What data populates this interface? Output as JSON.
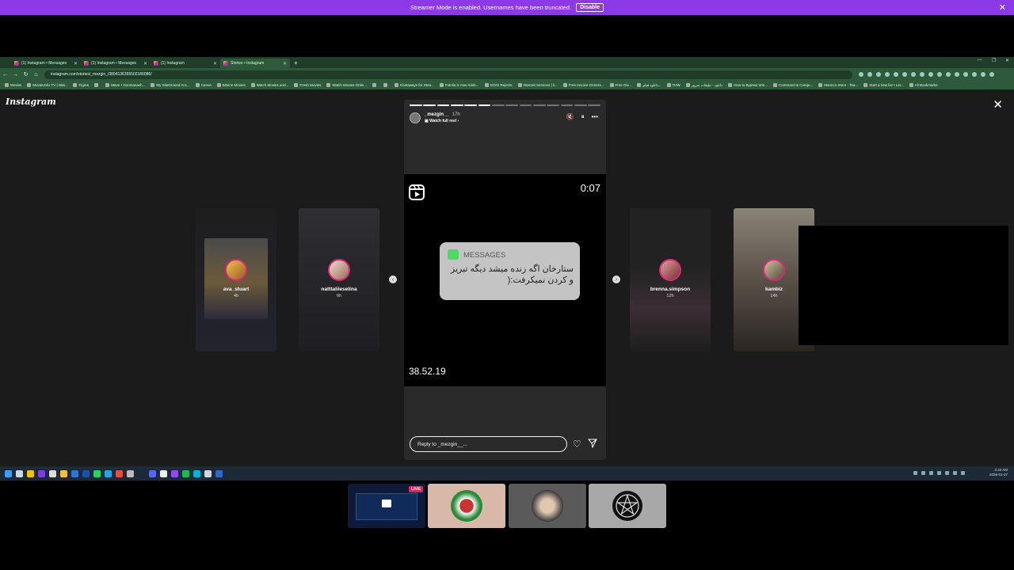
{
  "banner": {
    "text": "Streamer Mode is enabled. Usernames have been truncated.",
    "disable_label": "Disable",
    "close": "✕",
    "color": "#8c3ae8"
  },
  "browser": {
    "tabs": [
      {
        "label": "(1) Instagram • Messages",
        "active": false
      },
      {
        "label": "(1) Instagram • Messages",
        "active": false
      },
      {
        "label": "(1) Instagram",
        "active": false
      },
      {
        "label": "Stories • Instagram",
        "active": true
      }
    ],
    "new_tab": "+",
    "url": "instagram.com/stories/_mezgin_/3804136355502186086/",
    "bookmarks": [
      "Movies",
      "MovieUniU TV | Wat...",
      "Figma",
      "",
      "Wave • Hoomanash...",
      "My SiteGround Acc...",
      "Canva",
      "Bitvine Movies",
      "Watch Movies and...",
      "Fresh Movies",
      "Watch Movies Onlin...",
      "",
      "",
      "Giveaways for Stea...",
      "Fotolia is now Adob...",
      "GOGI Rejects",
      "Internet Services | li...",
      "Free Invoice Genera...",
      "Free Giv...",
      "دانلود فیلم...",
      "THW",
      "دانلود - تبلیغات سرور",
      "How to Bypass Win...",
      "Command & Conqu...",
      "Mannco.Store - Tea...",
      "Start a new list • Let...",
      "All Bookmarks"
    ],
    "window_controls": [
      "—",
      "❐",
      "✕"
    ]
  },
  "instagram": {
    "logo": "Instagram",
    "close": "✕",
    "side_stories": [
      {
        "username": "ava_stuart",
        "time": "4h"
      },
      {
        "username": "natttaliieselina",
        "time": "6h"
      },
      {
        "username": "brenna.simpson",
        "time": "12h"
      },
      {
        "username": "kambiz",
        "time": "14h"
      }
    ],
    "story": {
      "username": "_mezgin__",
      "time": "17h",
      "watch_label": "Watch full reel",
      "controls": {
        "mute": "🔇",
        "pause": "⏸",
        "more": "•••"
      },
      "video_timer": "0:07",
      "message_header": "MESSAGES",
      "message_text": "ستارخان اگه زنده میشد دیگه تبریز و کردن نمیکرفت:(",
      "footer_text": "38.52.19",
      "reply_placeholder": "Reply to _mezgin__...",
      "progress_done": 6,
      "progress_total": 14
    },
    "prev": "‹",
    "next": "›"
  },
  "taskbar": {
    "time": "2:43 AM",
    "date": "2026-01-07",
    "lang": "ENG US"
  },
  "participants": {
    "live_label": "LIVE",
    "tiles": [
      "screen-share",
      "user-flag-avatar",
      "user-photo",
      "user-pentagram-avatar"
    ]
  }
}
